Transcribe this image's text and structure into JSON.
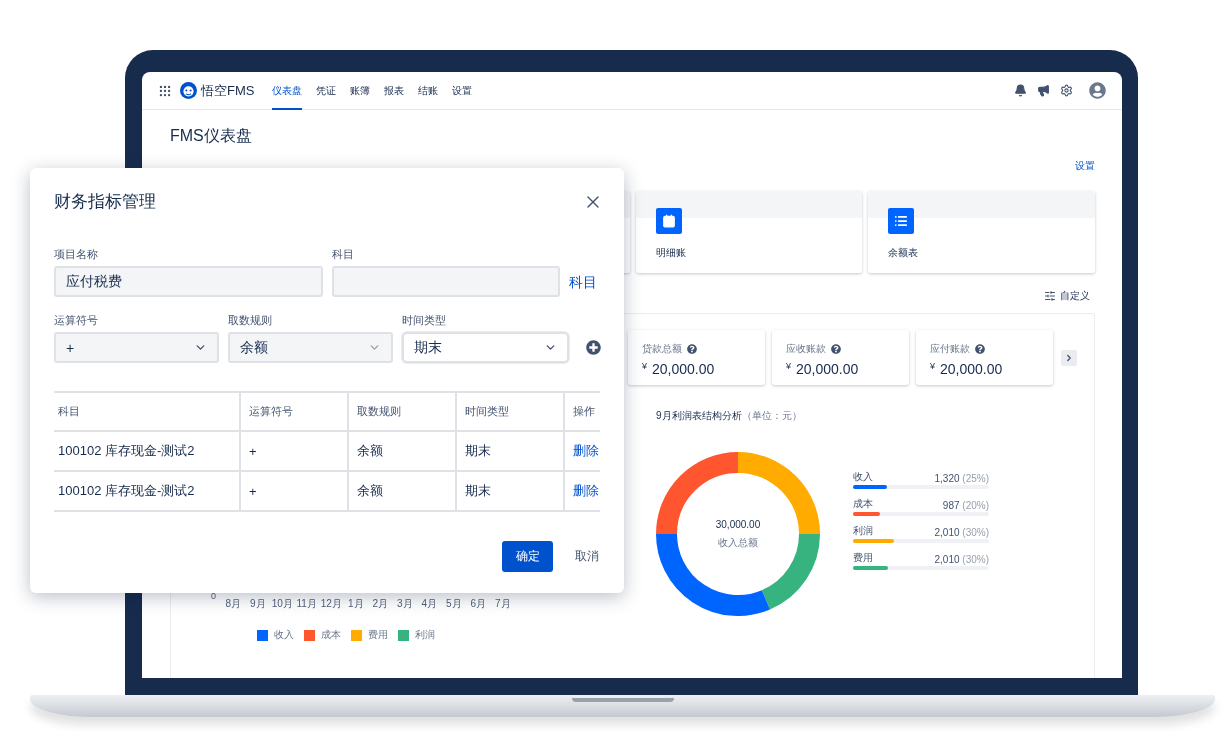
{
  "nav": {
    "app_name": "悟空FMS",
    "tabs": [
      {
        "label": "仪表盘",
        "selected": true
      },
      {
        "label": "凭证",
        "selected": false
      },
      {
        "label": "账簿",
        "selected": false
      },
      {
        "label": "报表",
        "selected": false
      },
      {
        "label": "结账",
        "selected": false
      },
      {
        "label": "设置",
        "selected": false
      }
    ]
  },
  "page": {
    "title": "FMS仪表盘",
    "settings_link": "设置",
    "shortcuts": [
      {
        "label": "明细账",
        "kind": "calendar"
      },
      {
        "label": "余额表",
        "kind": "list"
      }
    ],
    "customize": "自定义",
    "metrics": [
      {
        "label": "贷款总额",
        "currency": "¥",
        "amount": "20,000.00"
      },
      {
        "label": "应收账款",
        "currency": "¥",
        "amount": "20,000.00"
      },
      {
        "label": "应付账款",
        "currency": "¥",
        "amount": "20,000.00"
      }
    ],
    "bar_chart": {
      "zero_label": "0",
      "months": [
        "8月",
        "9月",
        "10月",
        "11月",
        "12月",
        "1月",
        "2月",
        "3月",
        "4月",
        "5月",
        "6月",
        "7月"
      ],
      "legend": [
        {
          "label": "收入",
          "color": "#0065ff"
        },
        {
          "label": "成本",
          "color": "#ff5630"
        },
        {
          "label": "费用",
          "color": "#ffab00"
        },
        {
          "label": "利润",
          "color": "#36b37e"
        }
      ]
    },
    "structure": {
      "title": "9月利润表结构分析",
      "unit": "（单位：元）",
      "center_value": "30,000.00",
      "center_label": "收入总额",
      "items": [
        {
          "label": "收入",
          "amount": "1,320",
          "share": "(25%)",
          "color": "#0065ff",
          "level": 0.25
        },
        {
          "label": "成本",
          "amount": "987",
          "share": "(20%)",
          "color": "#ff5630",
          "level": 0.2
        },
        {
          "label": "利润",
          "amount": "2,010",
          "share": "(30%)",
          "color": "#ffab00",
          "level": 0.3
        },
        {
          "label": "费用",
          "amount": "2,010",
          "share": "(30%)",
          "color": "#36b37e",
          "level": 0.26
        }
      ]
    }
  },
  "modal": {
    "title": "财务指标管理",
    "name_field": {
      "label": "项目名称",
      "value": "应付税费"
    },
    "subject_field": {
      "label": "科目"
    },
    "subject_link": "科目",
    "selects": [
      {
        "label": "运算符号",
        "value": "+",
        "focused": false
      },
      {
        "label": "取数规则",
        "value": "余额",
        "focused": false
      },
      {
        "label": "时间类型",
        "value": "期末",
        "focused": true
      }
    ],
    "table": {
      "columns": [
        "科目",
        "运算符号",
        "取数规则",
        "时间类型",
        "操作"
      ],
      "rows": [
        {
          "cells": [
            "100102 库存现金-测试2",
            "+",
            "余额",
            "期末"
          ],
          "action": "删除"
        },
        {
          "cells": [
            "100102 库存现金-测试2",
            "+",
            "余额",
            "期末"
          ],
          "action": "删除"
        }
      ]
    },
    "confirm": "确定",
    "cancel": "取消"
  }
}
